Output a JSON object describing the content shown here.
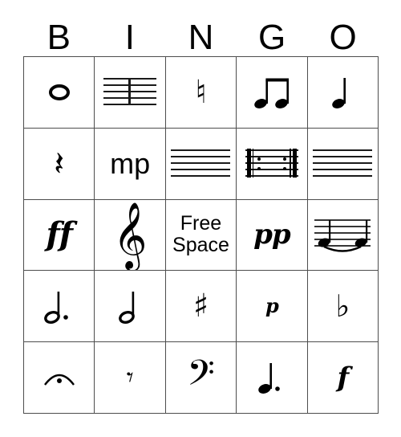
{
  "card": {
    "title": "Music Symbols Bingo Card",
    "headers": [
      "B",
      "I",
      "N",
      "G",
      "O"
    ],
    "free_space_text": "Free\nSpace",
    "free_space_line1": "Free",
    "free_space_line2": "Space",
    "grid_color": "#4d4d4d",
    "ink_color": "#000000",
    "background_color": "#ffffff",
    "rows": 5,
    "columns": 5,
    "cells": [
      [
        {
          "id": "B1",
          "symbol": "whole-note",
          "label": "Whole Note",
          "kind": "note",
          "text": ""
        },
        {
          "id": "I1",
          "symbol": "barline-on-staff",
          "label": "Bar Line",
          "kind": "staff",
          "text": ""
        },
        {
          "id": "N1",
          "symbol": "natural-sign",
          "label": "Natural",
          "kind": "glyph",
          "text": "♮"
        },
        {
          "id": "G1",
          "symbol": "beamed-eighth-notes",
          "label": "Two Beamed Eighth Notes",
          "kind": "note",
          "text": ""
        },
        {
          "id": "O1",
          "symbol": "quarter-note",
          "label": "Quarter Note",
          "kind": "note",
          "text": ""
        }
      ],
      [
        {
          "id": "B2",
          "symbol": "quarter-rest",
          "label": "Quarter Rest",
          "kind": "glyph",
          "text": "𝄽"
        },
        {
          "id": "I2",
          "symbol": "dynamic-mezzo-piano",
          "label": "Mezzo Piano",
          "kind": "text",
          "text": "mp"
        },
        {
          "id": "N2",
          "symbol": "staff-five-lines",
          "label": "Staff",
          "kind": "staff",
          "text": ""
        },
        {
          "id": "G2",
          "symbol": "repeat-sign",
          "label": "Repeat Sign",
          "kind": "staff",
          "text": ""
        },
        {
          "id": "O2",
          "symbol": "staff-five-lines",
          "label": "Staff",
          "kind": "staff",
          "text": ""
        }
      ],
      [
        {
          "id": "B3",
          "symbol": "dynamic-fortissimo",
          "label": "Fortissimo",
          "kind": "dynamic",
          "text": "ff"
        },
        {
          "id": "I3",
          "symbol": "treble-clef",
          "label": "Treble Clef",
          "kind": "glyph",
          "text": "𝄞"
        },
        {
          "id": "N3",
          "symbol": "free-space",
          "label": "Free Space",
          "kind": "free",
          "text": "Free Space"
        },
        {
          "id": "G3",
          "symbol": "dynamic-pianissimo",
          "label": "Pianissimo",
          "kind": "dynamic",
          "text": "pp"
        },
        {
          "id": "O3",
          "symbol": "slur-two-notes",
          "label": "Slur",
          "kind": "staff",
          "text": ""
        }
      ],
      [
        {
          "id": "B4",
          "symbol": "dotted-half-note",
          "label": "Dotted Half Note",
          "kind": "note",
          "text": ""
        },
        {
          "id": "I4",
          "symbol": "half-note",
          "label": "Half Note",
          "kind": "note",
          "text": ""
        },
        {
          "id": "N4",
          "symbol": "sharp-sign",
          "label": "Sharp",
          "kind": "glyph",
          "text": "♯"
        },
        {
          "id": "G4",
          "symbol": "dynamic-piano",
          "label": "Piano",
          "kind": "dynamic",
          "text": "p"
        },
        {
          "id": "O4",
          "symbol": "flat-sign",
          "label": "Flat",
          "kind": "glyph",
          "text": "♭"
        }
      ],
      [
        {
          "id": "B5",
          "symbol": "fermata",
          "label": "Fermata",
          "kind": "glyph",
          "text": "𝄐"
        },
        {
          "id": "I5",
          "symbol": "eighth-rest",
          "label": "Eighth Rest",
          "kind": "glyph",
          "text": "𝄾"
        },
        {
          "id": "N5",
          "symbol": "bass-clef",
          "label": "Bass Clef",
          "kind": "glyph",
          "text": "𝄢"
        },
        {
          "id": "G5",
          "symbol": "dotted-quarter-note",
          "label": "Dotted Quarter Note",
          "kind": "note",
          "text": ""
        },
        {
          "id": "O5",
          "symbol": "dynamic-forte",
          "label": "Forte",
          "kind": "dynamic",
          "text": "f"
        }
      ]
    ]
  }
}
